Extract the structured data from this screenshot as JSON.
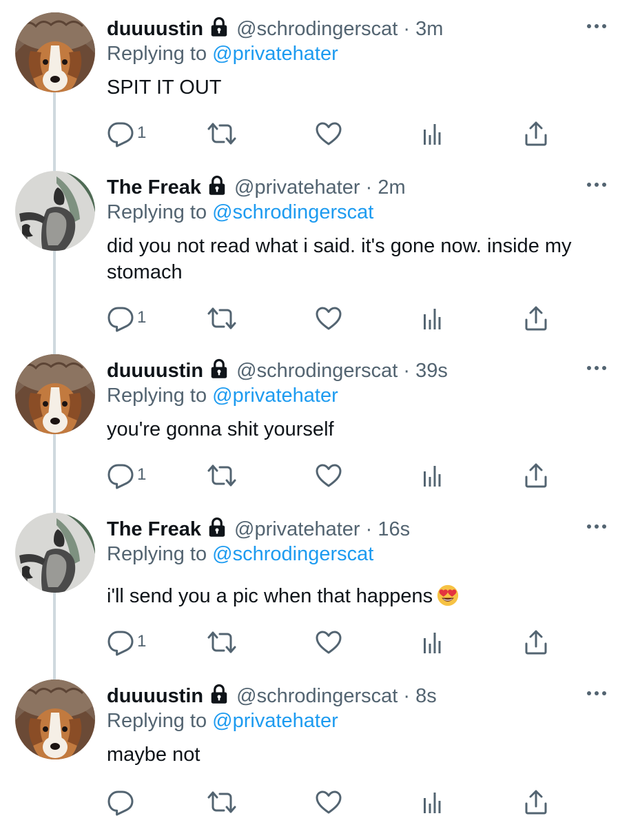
{
  "tweets": [
    {
      "name": "duuuustin",
      "handle": "@schrodingerscat",
      "separator": "·",
      "time": "3m",
      "replying_prefix": "Replying to",
      "replying_to": "@privatehater",
      "text": "SPIT IT OUT",
      "reply_count": "1",
      "avatar": "dog-in-fur-hat"
    },
    {
      "name": "The Freak",
      "handle": "@privatehater",
      "separator": "·",
      "time": "2m",
      "replying_prefix": "Replying to",
      "replying_to": "@schrodingerscat",
      "text": "did you not read what i said. it's gone now. inside my stomach",
      "reply_count": "1",
      "avatar": "engraving-figure"
    },
    {
      "name": "duuuustin",
      "handle": "@schrodingerscat",
      "separator": "·",
      "time": "39s",
      "replying_prefix": "Replying to",
      "replying_to": "@privatehater",
      "text": "you're gonna shit yourself",
      "reply_count": "1",
      "avatar": "dog-in-fur-hat"
    },
    {
      "name": "The Freak",
      "handle": "@privatehater",
      "separator": "·",
      "time": "16s",
      "replying_prefix": "Replying to",
      "replying_to": "@schrodingerscat",
      "text": "i'll send you a pic when that happens",
      "text_emoji": "heart-eyes-emoji",
      "reply_count": "1",
      "avatar": "engraving-figure"
    },
    {
      "name": "duuuustin",
      "handle": "@schrodingerscat",
      "separator": "·",
      "time": "8s",
      "replying_prefix": "Replying to",
      "replying_to": "@privatehater",
      "text": "maybe not",
      "reply_count": "",
      "avatar": "dog-in-fur-hat"
    }
  ],
  "icons": {
    "lock": "lock-icon",
    "more": "more-icon",
    "reply": "reply-icon",
    "retweet": "retweet-icon",
    "like": "like-icon",
    "views": "analytics-icon",
    "share": "share-icon"
  },
  "colors": {
    "text": "#0f1419",
    "secondary": "#536471",
    "link": "#1d9bf0",
    "thread_line": "#cfd9de"
  }
}
